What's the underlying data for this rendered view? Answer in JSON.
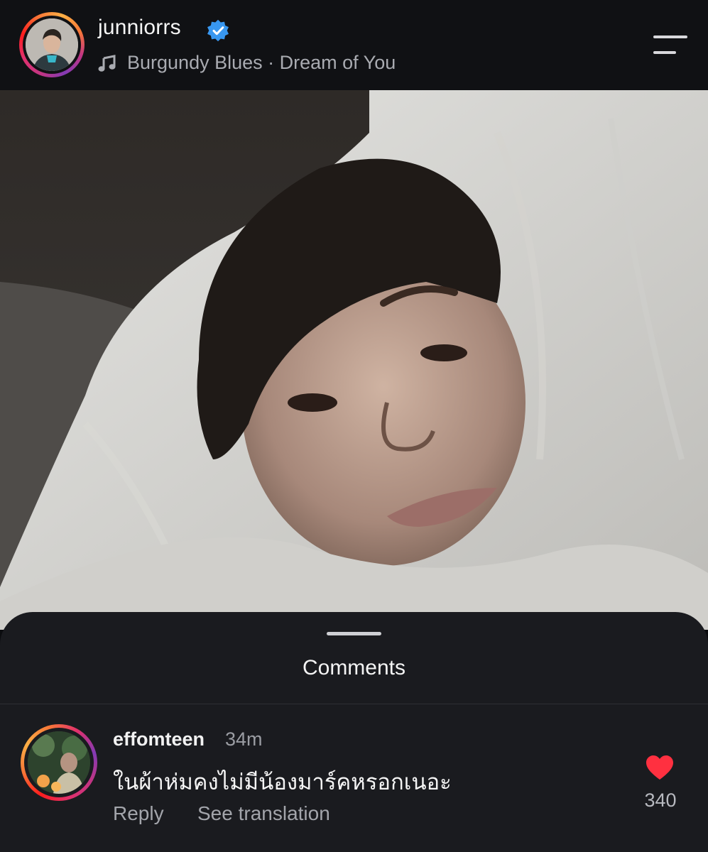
{
  "header": {
    "username": "junniorrs",
    "song": "Burgundy Blues · Dream of You",
    "icons": {
      "verified": "verified-badge-icon",
      "music": "music-note-icon",
      "menu": "menu-icon"
    },
    "colors": {
      "verified": "#3897f0"
    }
  },
  "post": {
    "image": "photo"
  },
  "comments_sheet": {
    "title": "Comments",
    "comment": {
      "username": "effomteen",
      "time": "34m",
      "text": "ในผ้าห่มคงไม่มีน้องมาร์คหรอกเนอะ",
      "reply_label": "Reply",
      "translate_label": "See translation",
      "likes": "340",
      "like_icon": "heart-icon",
      "like_color": "#ff3040"
    }
  }
}
